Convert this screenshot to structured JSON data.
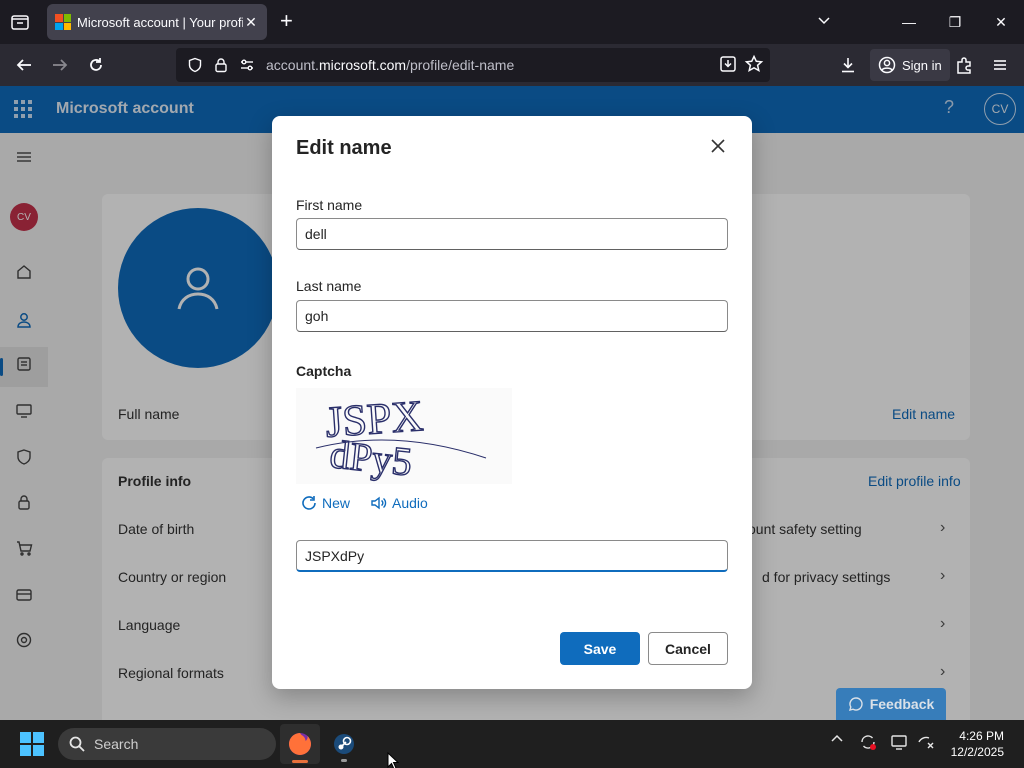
{
  "browser": {
    "tab_title": "Microsoft account | Your profile",
    "url_prefix": "account.",
    "url_domain": "microsoft.com",
    "url_path": "/profile/edit-name",
    "signin_label": "Sign in"
  },
  "app": {
    "brand": "Microsoft account",
    "help_label": "?",
    "avatar_initials": "CV"
  },
  "sidebar": {
    "avatar_initials": "CV"
  },
  "profile": {
    "full_name_label": "Full name",
    "edit_name_link": "Edit name",
    "profile_info_title": "Profile info",
    "edit_profile_info_link": "Edit profile info",
    "rows": [
      {
        "label": "Date of birth",
        "right_text": "ount safety setting"
      },
      {
        "label": "Country or region",
        "right_text": "d for privacy settings"
      },
      {
        "label": "Language",
        "right_text": ""
      },
      {
        "label": "Regional formats",
        "right_text": ""
      }
    ]
  },
  "dialog": {
    "title": "Edit name",
    "first_name_label": "First name",
    "first_name_value": "dell",
    "last_name_label": "Last name",
    "last_name_value": "goh",
    "captcha_label": "Captcha",
    "captcha_line1": "JSPX",
    "captcha_line2": "dPy5",
    "new_label": "New",
    "audio_label": "Audio",
    "captcha_value": "JSPXdPy",
    "save_label": "Save",
    "cancel_label": "Cancel"
  },
  "feedback_label": "Feedback",
  "taskbar": {
    "search_placeholder": "Search",
    "time": "4:26 PM",
    "date": "12/2/2025"
  },
  "colors": {
    "accent": "#0f6cbd",
    "browser_bg": "#1c1b22",
    "taskbar_bg": "#1f1f1f"
  }
}
